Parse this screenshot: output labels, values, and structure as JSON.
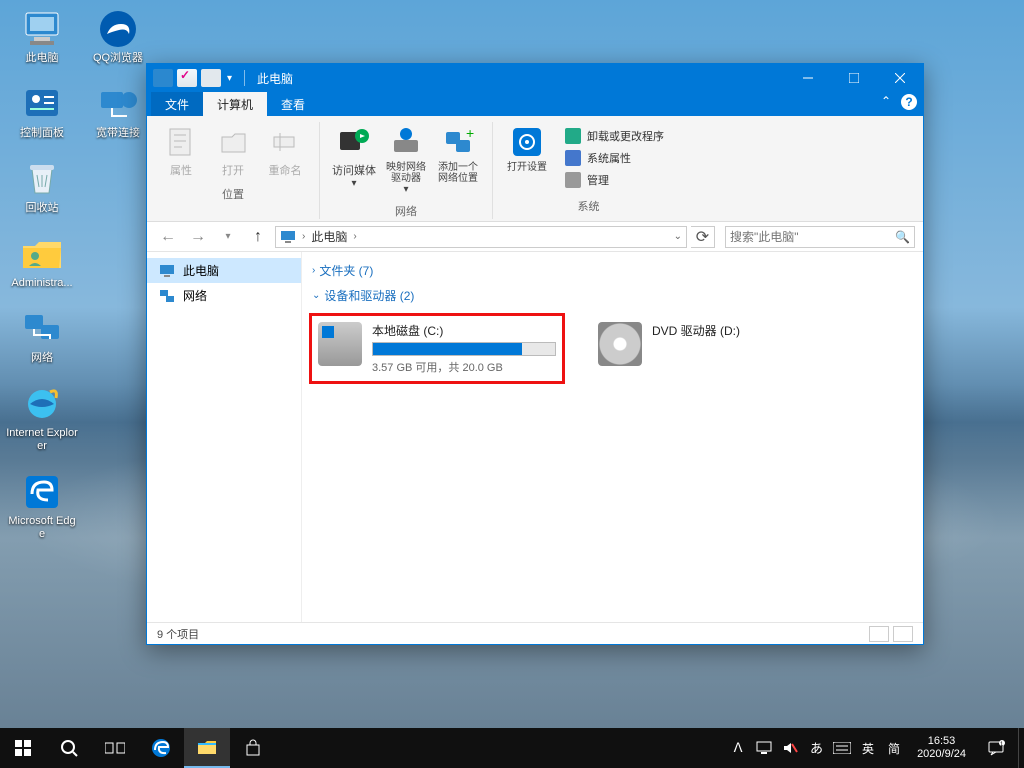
{
  "desktop": {
    "icons_col1": [
      {
        "key": "pc",
        "label": "此电脑"
      },
      {
        "key": "ctrl",
        "label": "控制面板"
      },
      {
        "key": "recycle",
        "label": "回收站"
      },
      {
        "key": "admin",
        "label": "Administra..."
      },
      {
        "key": "net",
        "label": "网络"
      },
      {
        "key": "ie",
        "label": "Internet Explorer"
      },
      {
        "key": "edge",
        "label": "Microsoft Edge"
      }
    ],
    "icons_col2": [
      {
        "key": "qq",
        "label": "QQ浏览器"
      },
      {
        "key": "dial",
        "label": "宽带连接"
      }
    ]
  },
  "window": {
    "title": "此电脑",
    "tabs": {
      "file": "文件",
      "computer": "计算机",
      "view": "查看"
    },
    "ribbon": {
      "group_location": "位置",
      "group_network": "网络",
      "group_system": "系统",
      "properties": "属性",
      "open": "打开",
      "rename": "重命名",
      "media": "访问媒体",
      "mapdrive": "映射网络驱动器",
      "addloc": "添加一个网络位置",
      "settings": "打开设置",
      "uninstall": "卸载或更改程序",
      "sysprops": "系统属性",
      "manage": "管理"
    },
    "breadcrumb": {
      "root": "此电脑"
    },
    "search_placeholder": "搜索\"此电脑\"",
    "nav": {
      "pc": "此电脑",
      "network": "网络"
    },
    "folders_hdr": "文件夹 (7)",
    "devices_hdr": "设备和驱动器 (2)",
    "drive_c": {
      "title": "本地磁盘 (C:)",
      "detail": "3.57 GB 可用，共 20.0 GB",
      "fill_pct": 82
    },
    "drive_d": {
      "title": "DVD 驱动器 (D:)"
    },
    "status": "9 个项目"
  },
  "taskbar": {
    "tray": {
      "ime1": "英",
      "ime2": "简"
    },
    "clock": {
      "time": "16:53",
      "date": "2020/9/24"
    }
  }
}
